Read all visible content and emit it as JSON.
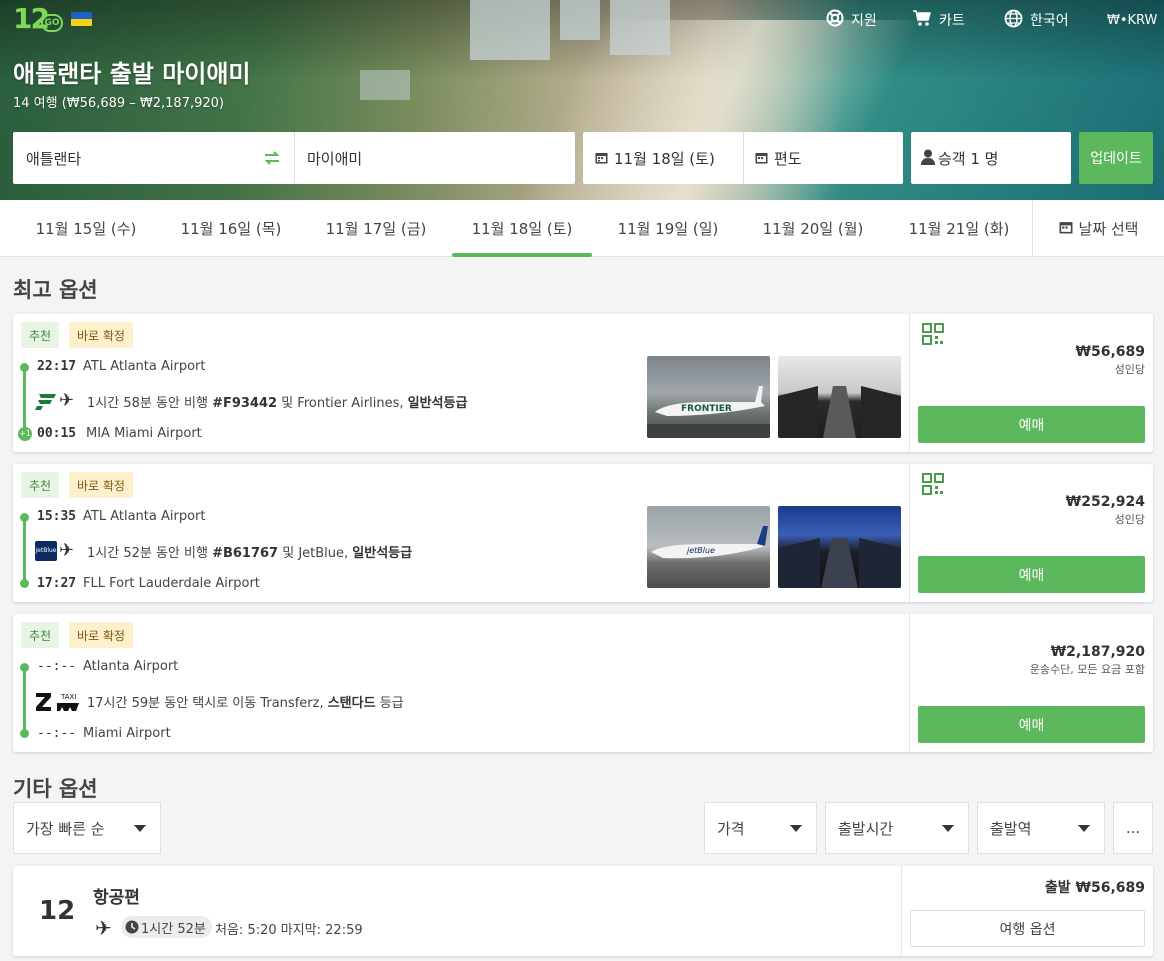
{
  "header": {
    "logo_text": "12",
    "logo_sub": "GO",
    "nav": {
      "support": "지원",
      "cart": "카트",
      "language": "한국어",
      "currency": "₩•KRW"
    },
    "title": "애틀랜타 출발 마이애미",
    "subtitle": "14 여행 (₩56,689 – ₩2,187,920)"
  },
  "search": {
    "from": "애틀랜타",
    "to": "마이애미",
    "date": "11월 18일 (토)",
    "return": "편도",
    "passengers": "승객 1 명",
    "update_label": "업데이트"
  },
  "date_tabs": [
    {
      "label": "11월 15일 (수)"
    },
    {
      "label": "11월 16일 (목)"
    },
    {
      "label": "11월 17일 (금)"
    },
    {
      "label": "11월 18일 (토)",
      "active": true
    },
    {
      "label": "11월 19일 (일)"
    },
    {
      "label": "11월 20일 (월)"
    },
    {
      "label": "11월 21일 (화)"
    }
  ],
  "date_pick_label": "날짜 선택",
  "best": {
    "heading": "최고 옵션",
    "cards": [
      {
        "badge1": "추천",
        "badge2": "바로 확정",
        "dep_time": "22:17",
        "dep_place": "ATL Atlanta Airport",
        "arr_time": "00:15",
        "arr_place": "MIA Miami Airport",
        "plus_day": "+1",
        "desc_pre": "1시간 58분 동안 비행 ",
        "flight_no": "#F93442",
        "desc_mid": " 및 Frontier Airlines, ",
        "class": "일반석등급",
        "price": "₩56,689",
        "unit": "성인당",
        "book": "예매",
        "carrier_icon": "frontier-logo",
        "color": "#1a7a3b"
      },
      {
        "badge1": "추천",
        "badge2": "바로 확정",
        "dep_time": "15:35",
        "dep_place": "ATL Atlanta Airport",
        "arr_time": "17:27",
        "arr_place": "FLL Fort Lauderdale Airport",
        "desc_pre": "1시간 52분 동안 비행 ",
        "flight_no": "#B61767",
        "desc_mid": " 및 JetBlue, ",
        "class": "일반석등급",
        "price": "₩252,924",
        "unit": "성인당",
        "book": "예매",
        "carrier_icon": "jetblue-logo",
        "carrier_text": "jetBlue",
        "color": "#0b2c63"
      },
      {
        "badge1": "추천",
        "badge2": "바로 확정",
        "dep_time": "--:--",
        "dep_place": "Atlanta Airport",
        "arr_time": "--:--",
        "arr_place": "Miami Airport",
        "desc_pre": "17시간 59분 동안 택시로 이동 Transferz, ",
        "class": "스탠다드",
        "desc_post": " 등급",
        "price": "₩2,187,920",
        "unit": "운송수단, 모든 요금 포함",
        "book": "예매",
        "carrier_icon": "zebra-taxi-logo",
        "carrier_text": "TAXI"
      }
    ]
  },
  "other": {
    "heading": "기타 옵션",
    "sort": "가장 빠른 순",
    "filters": [
      "가격",
      "출발시간",
      "출발역"
    ],
    "more": "...",
    "summary": {
      "count": "12",
      "kind": "항공편",
      "duration": "1시간 52분",
      "range": "처음: 5:20 마지막: 22:59",
      "from_price": "출발 ₩56,689",
      "options_label": "여행 옵션"
    }
  },
  "colors": {
    "accent": "#5cb85c",
    "badge_green_bg": "#e8f5e5",
    "badge_yellow_bg": "#fff0cc"
  }
}
